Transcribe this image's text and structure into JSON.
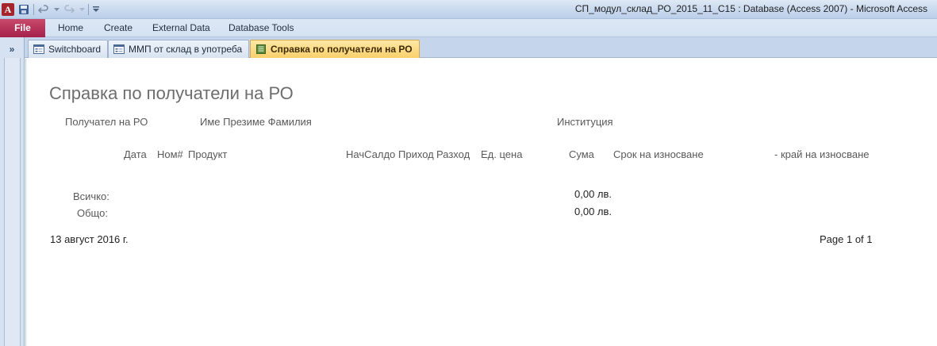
{
  "titlebar": {
    "app_icon_letter": "A",
    "title": "СП_модул_склад_РО_2015_11_С15 : Database (Access 2007)  -  Microsoft Access"
  },
  "ribbon": {
    "file_label": "File",
    "tabs": [
      "Home",
      "Create",
      "External Data",
      "Database Tools"
    ]
  },
  "nav": {
    "toggle_glyph": "»"
  },
  "doc_tabs": [
    {
      "label": "Switchboard",
      "icon": "form-icon",
      "active": false
    },
    {
      "label": "ММП от склад в употреба",
      "icon": "form-icon",
      "active": false
    },
    {
      "label": "Справка по получатели на РО",
      "icon": "report-icon",
      "active": true
    }
  ],
  "report": {
    "title": "Справка по получатели на РО",
    "header": {
      "recipient_label": "Получател на РО",
      "name_label": "Име Презиме Фамилия",
      "institution_label": "Институция"
    },
    "columns": {
      "date": "Дата",
      "number": "Ном#",
      "product": "Продукт",
      "opening": "НачСалдо",
      "income": "Приход",
      "expense": "Разход",
      "unit_price": "Ед. цена",
      "sum": "Сума",
      "wear_term": "Срок на износване",
      "wear_end": "- край на износване"
    },
    "totals": {
      "all_label": "Всичко:",
      "all_value": "0,00 лв.",
      "grand_label": "Общо:",
      "grand_value": "0,00 лв."
    },
    "footer": {
      "date": "13 август 2016 г.",
      "page": "Page 1 of 1"
    }
  }
}
